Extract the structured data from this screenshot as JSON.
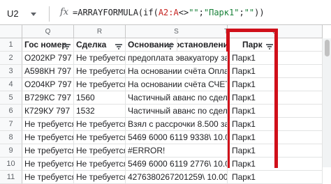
{
  "namebox": "U2",
  "formula": {
    "prefix": "=ARRAYFORMULA(if(",
    "range": "A2:A",
    "op": "<>",
    "q1": "\"\"",
    "semi": ";",
    "s1": "\"Парк1\"",
    "semi2": ";",
    "s2": "\"\"",
    "suffix": "))"
  },
  "columns": [
    "Q",
    "R",
    "S",
    "T",
    "U"
  ],
  "headers": [
    "Гос номер",
    "Сделка",
    "Основание",
    "остановлени",
    "Парк"
  ],
  "rows": [
    {
      "num": "1"
    },
    {
      "num": "2",
      "cells": [
        "О202КР 797",
        "Не требуется",
        "предоплата эвакуатору за дост",
        "",
        "Парк1"
      ]
    },
    {
      "num": "3",
      "cells": [
        "А598КН 797",
        "Не требуется",
        "На основании счёта Оплата по",
        "",
        "Парк1"
      ]
    },
    {
      "num": "4",
      "cells": [
        "О204КР 797",
        "Не требуется",
        "На основании счёта СЧЕТ yf jgk",
        "",
        "Парк1"
      ]
    },
    {
      "num": "5",
      "cells": [
        "В729КС 797",
        "1560",
        "Частичный аванс по сделке 156",
        "",
        "Парк1"
      ]
    },
    {
      "num": "6",
      "cells": [
        "К729КУ 797",
        "1532",
        "Частичный аванс по сделке 153",
        "",
        "Парк1"
      ]
    },
    {
      "num": "7",
      "cells": [
        "Не требуется",
        "Не требуется",
        "Взял с рассрочки 8.500 за сдел",
        "",
        "Парк1"
      ]
    },
    {
      "num": "8",
      "cells": [
        "Не требуется",
        "Не требуется",
        "5469 6000 6119 9338\\ 10.000 д",
        "",
        "Парк1"
      ]
    },
    {
      "num": "9",
      "cells": [
        "Не требуется",
        "Не требуется",
        "#ERROR!",
        "",
        "Парк1"
      ]
    },
    {
      "num": "10",
      "cells": [
        "Не требуется",
        "Не требуется",
        "5469 6000 6119 2776\\ 10.000 д",
        "",
        "Парк1"
      ]
    },
    {
      "num": "11",
      "cells": [
        "Не требуется",
        "Не требуется",
        "4276380267201259\\ 10.000 дл",
        "",
        "Парк1"
      ]
    }
  ],
  "colors": {
    "frame": "#d0101a",
    "formula_range": "#c5221f",
    "formula_string": "#188038"
  }
}
